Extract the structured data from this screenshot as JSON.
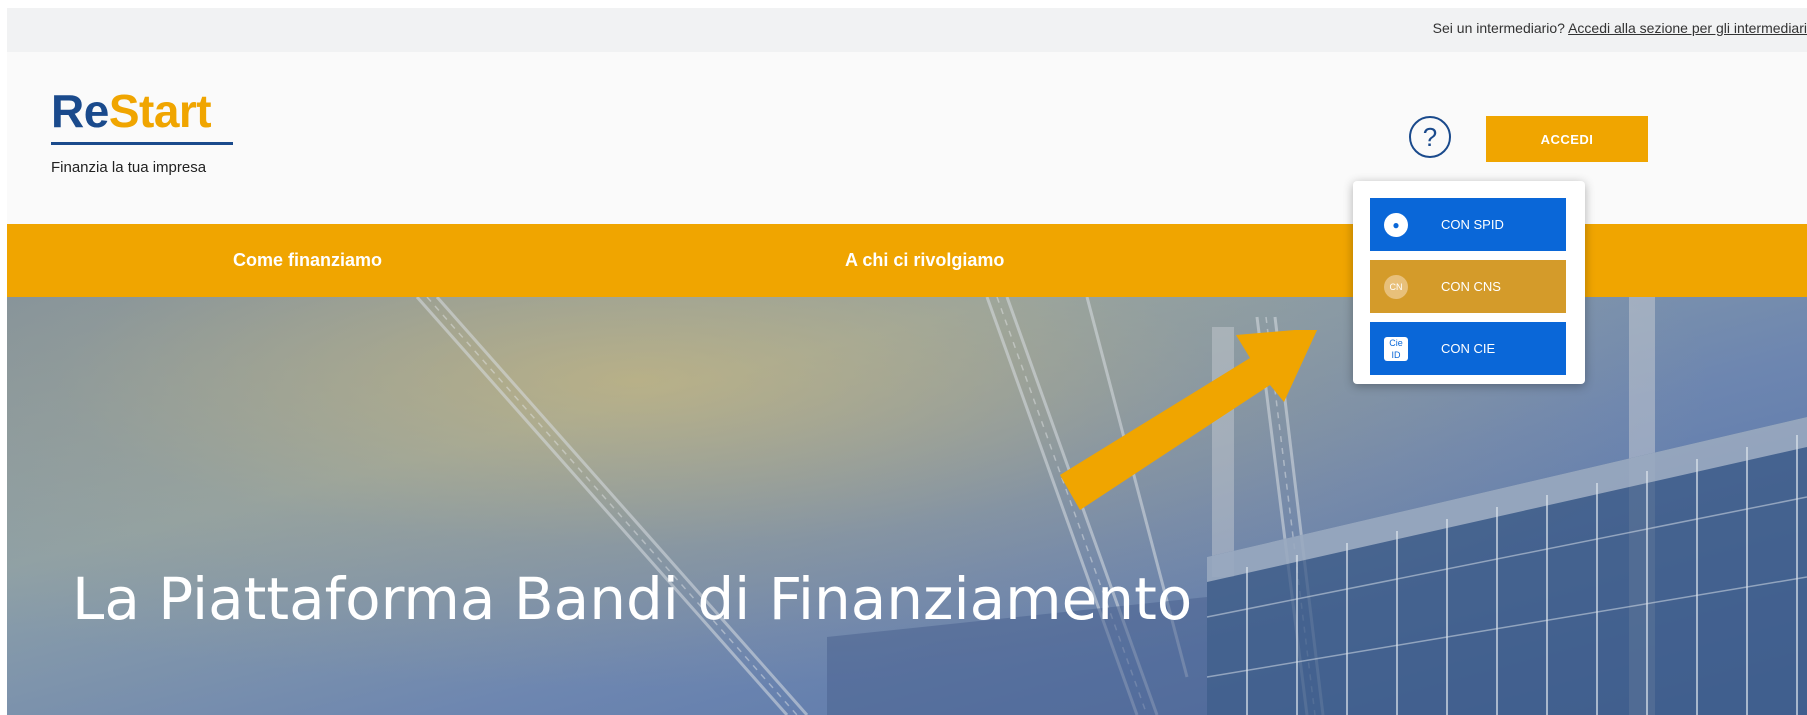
{
  "topbar": {
    "prefix": "Sei un intermediario?",
    "link": "Accedi alla sezione per gli intermediari"
  },
  "logo": {
    "part1": "Re",
    "part2": "Start",
    "tagline": "Finanzia la tua impresa"
  },
  "header": {
    "help_symbol": "?",
    "login_label": "ACCEDI"
  },
  "nav": {
    "items": [
      "Come finanziamo",
      "A chi ci rivolgiamo"
    ]
  },
  "login_menu": {
    "items": [
      {
        "label": "CON SPID",
        "icon": "spid-icon",
        "color": "#0a67d8"
      },
      {
        "label": "CON CNS",
        "icon": "cns-icon",
        "color": "#d49b2a"
      },
      {
        "label": "CON CIE",
        "icon": "cie-icon",
        "color": "#0a67d8"
      }
    ]
  },
  "hero": {
    "title": "La Piattaforma Bandi di Finanziamento"
  },
  "colors": {
    "brand_blue": "#1a4a8c",
    "brand_orange": "#f0a500",
    "button_blue": "#0a67d8"
  }
}
